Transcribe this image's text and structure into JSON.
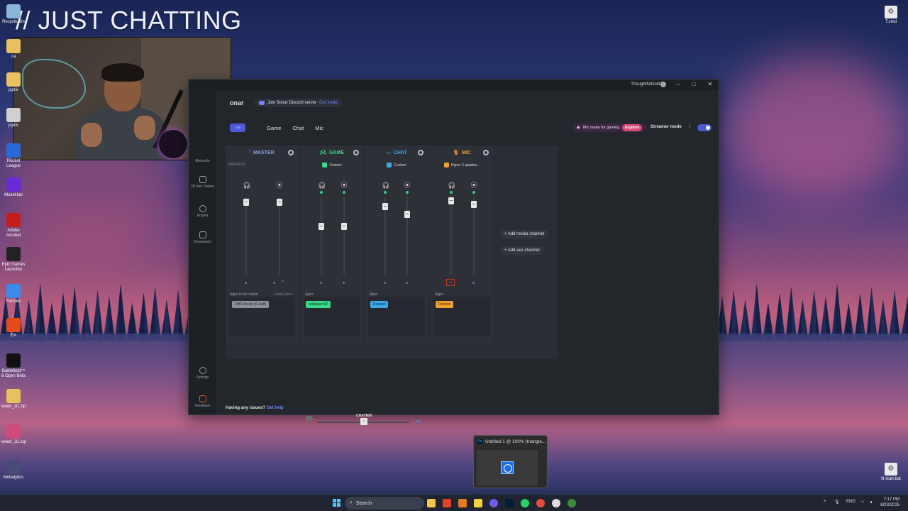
{
  "overlay": {
    "title": "// JUST CHATTING"
  },
  "desktop_icons": [
    {
      "label": "Recycle Bin",
      "icon": "recycle-bin-icon"
    },
    {
      "label": "ca",
      "icon": "folder-icon"
    },
    {
      "label": "jcpriv",
      "icon": "folder-icon"
    },
    {
      "label": "jcpriv",
      "icon": "file-icon"
    },
    {
      "label": "Rocket League",
      "icon": "rocket-league-icon"
    },
    {
      "label": "MuseHub",
      "icon": "musehub-icon"
    },
    {
      "label": "Adobe Acrobat",
      "icon": "acrobat-icon"
    },
    {
      "label": "Epic Games Launcher",
      "icon": "epic-games-icon"
    },
    {
      "label": "Fortnite",
      "icon": "fortnite-icon"
    },
    {
      "label": "EA",
      "icon": "ea-icon"
    },
    {
      "label": "Battlefield™ 6 Open Beta",
      "icon": "battlefield-icon"
    },
    {
      "label": "weed_JC.zip",
      "icon": "zip-folder-icon"
    },
    {
      "label": "weed_JC.sql",
      "icon": "sql-file-icon"
    },
    {
      "label": "Mobalytics",
      "icon": "mobalytics-icon"
    }
  ],
  "right_icons": [
    {
      "label": "T.cmd",
      "icon": "gear-file-icon"
    },
    {
      "label": "N start.bat",
      "icon": "gear-file-icon"
    }
  ],
  "sonar": {
    "user": "ThoughtfulGold24",
    "app_name": "onar",
    "discord_text": "Join Sonar Discord server",
    "discord_link": "Get Invite",
    "tabs": {
      "active": "Lux",
      "items": [
        "Game",
        "Chat",
        "Mic"
      ]
    },
    "promo_text": "Mic made for gaming",
    "promo_link": "Explore",
    "streamer_mode": "Streamer mode",
    "info": "i",
    "sidebar": [
      {
        "label": "Moments",
        "icon": "moments-icon"
      },
      {
        "label": "3D Aim Trainer",
        "icon": "aim-trainer-icon"
      },
      {
        "label": "Engine",
        "icon": "engine-icon"
      },
      {
        "label": "Giveaways",
        "icon": "giveaways-icon"
      },
      {
        "label": "Settings",
        "icon": "gear-icon"
      },
      {
        "label": "Feedback",
        "icon": "feedback-icon"
      }
    ],
    "channels": {
      "master": {
        "name": "MASTER",
        "sub": "PRESETS",
        "apps_label": "Apps to be routed",
        "learn": "Learn More",
        "chip": "OBS Studio (6-Edit)",
        "level_headphones": 0.93,
        "level_stream": 0.93
      },
      "game": {
        "name": "GAME",
        "sub": "Custom",
        "apps_label": "Apps",
        "chip": "wallpaper32",
        "level_headphones": 0.62,
        "level_stream": 0.62
      },
      "chat": {
        "name": "CHAT",
        "sub": "Custom",
        "apps_label": "Apps",
        "chip": "Discord",
        "level_headphones": 0.87,
        "level_stream": 0.77
      },
      "mic": {
        "name": "MIC",
        "sub": "Hyper X quadca...",
        "apps_label": "Apps",
        "chip": "Discord",
        "level_headphones": 0.95,
        "level_stream": 0.9
      }
    },
    "chatmix": {
      "label": "CHATMIX",
      "knob": "I"
    },
    "add_media": "+ Add media channel",
    "add_aux": "+ Add aux channel",
    "help_text": "Having any issues?",
    "help_link": "Get help"
  },
  "ps_preview": {
    "title": "Untitled-1 @ 100% (triangle..."
  },
  "taskbar": {
    "search": "Search",
    "lang": "ENG",
    "time": "7:17 PM",
    "date": "8/23/2025"
  },
  "colors": {
    "game": "#39d98a",
    "chat": "#3aa8e8",
    "mic": "#f0a030",
    "master": "#8a9cf0",
    "accent": "#4c5ad8"
  }
}
